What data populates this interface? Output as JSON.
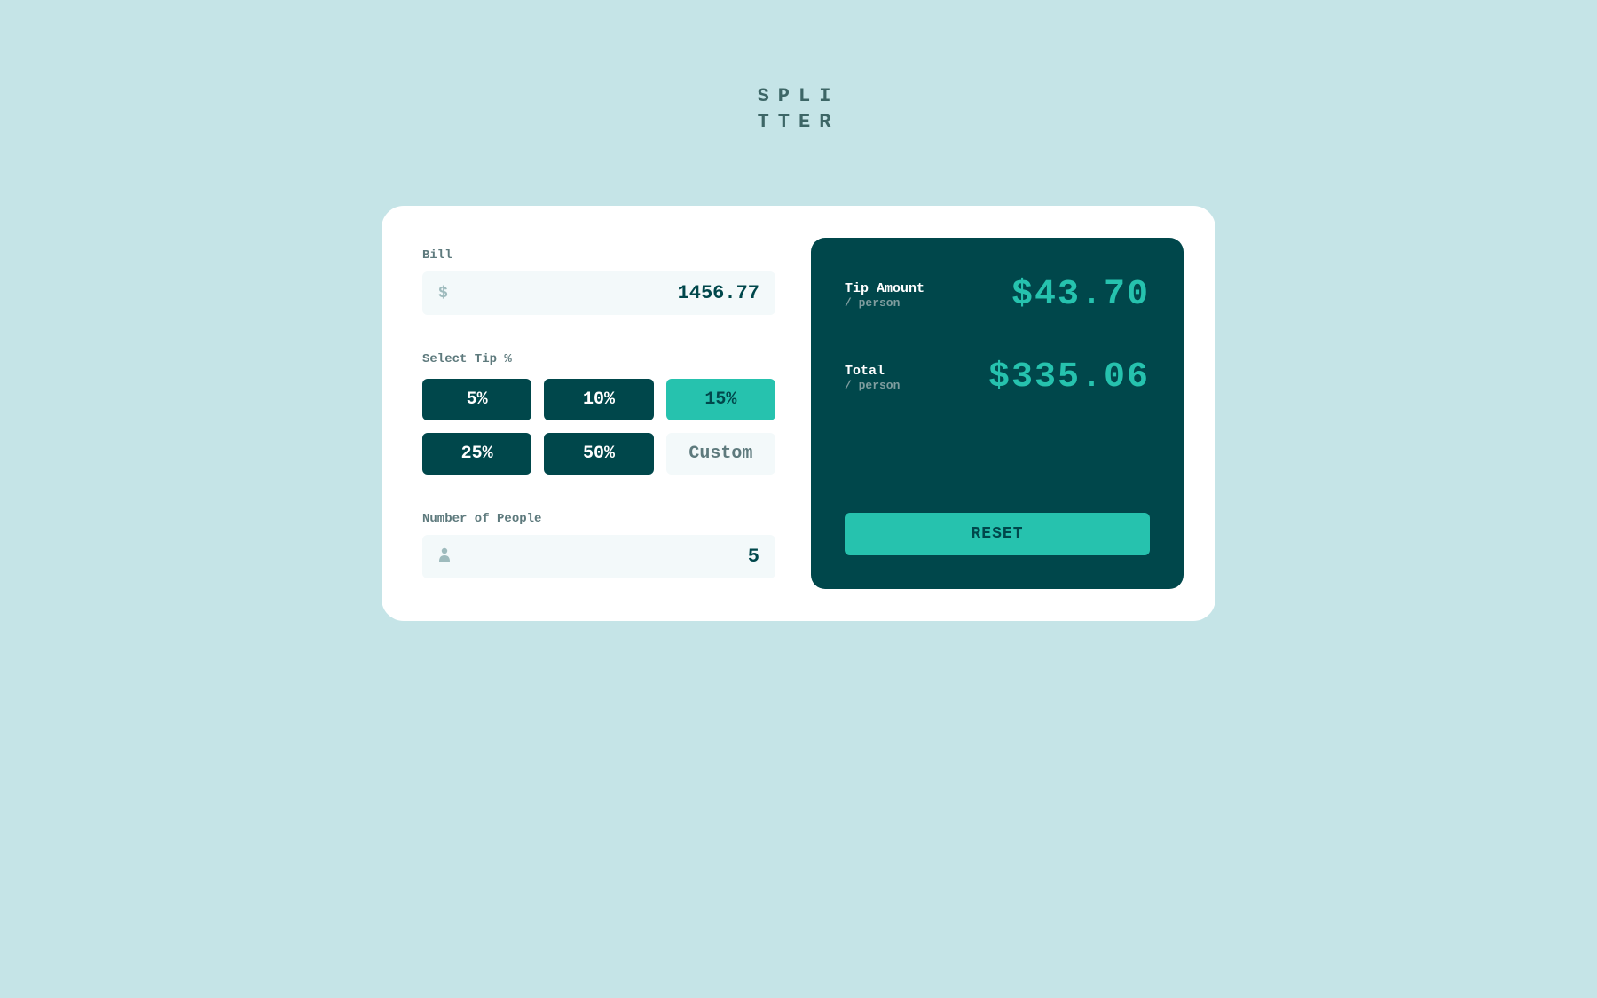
{
  "logo": {
    "line1": "SPLI",
    "line2": "TTER"
  },
  "inputs": {
    "bill": {
      "label": "Bill",
      "value": "1456.77",
      "icon": "$"
    },
    "tip": {
      "label": "Select Tip %",
      "options": [
        "5%",
        "10%",
        "15%",
        "25%",
        "50%"
      ],
      "selected_index": 2,
      "custom_placeholder": "Custom"
    },
    "people": {
      "label": "Number of People",
      "value": "5"
    }
  },
  "results": {
    "tip_amount": {
      "label": "Tip Amount",
      "sublabel": "/ person",
      "value": "$43.70"
    },
    "total": {
      "label": "Total",
      "sublabel": "/ person",
      "value": "$335.06"
    },
    "reset_label": "RESET"
  }
}
